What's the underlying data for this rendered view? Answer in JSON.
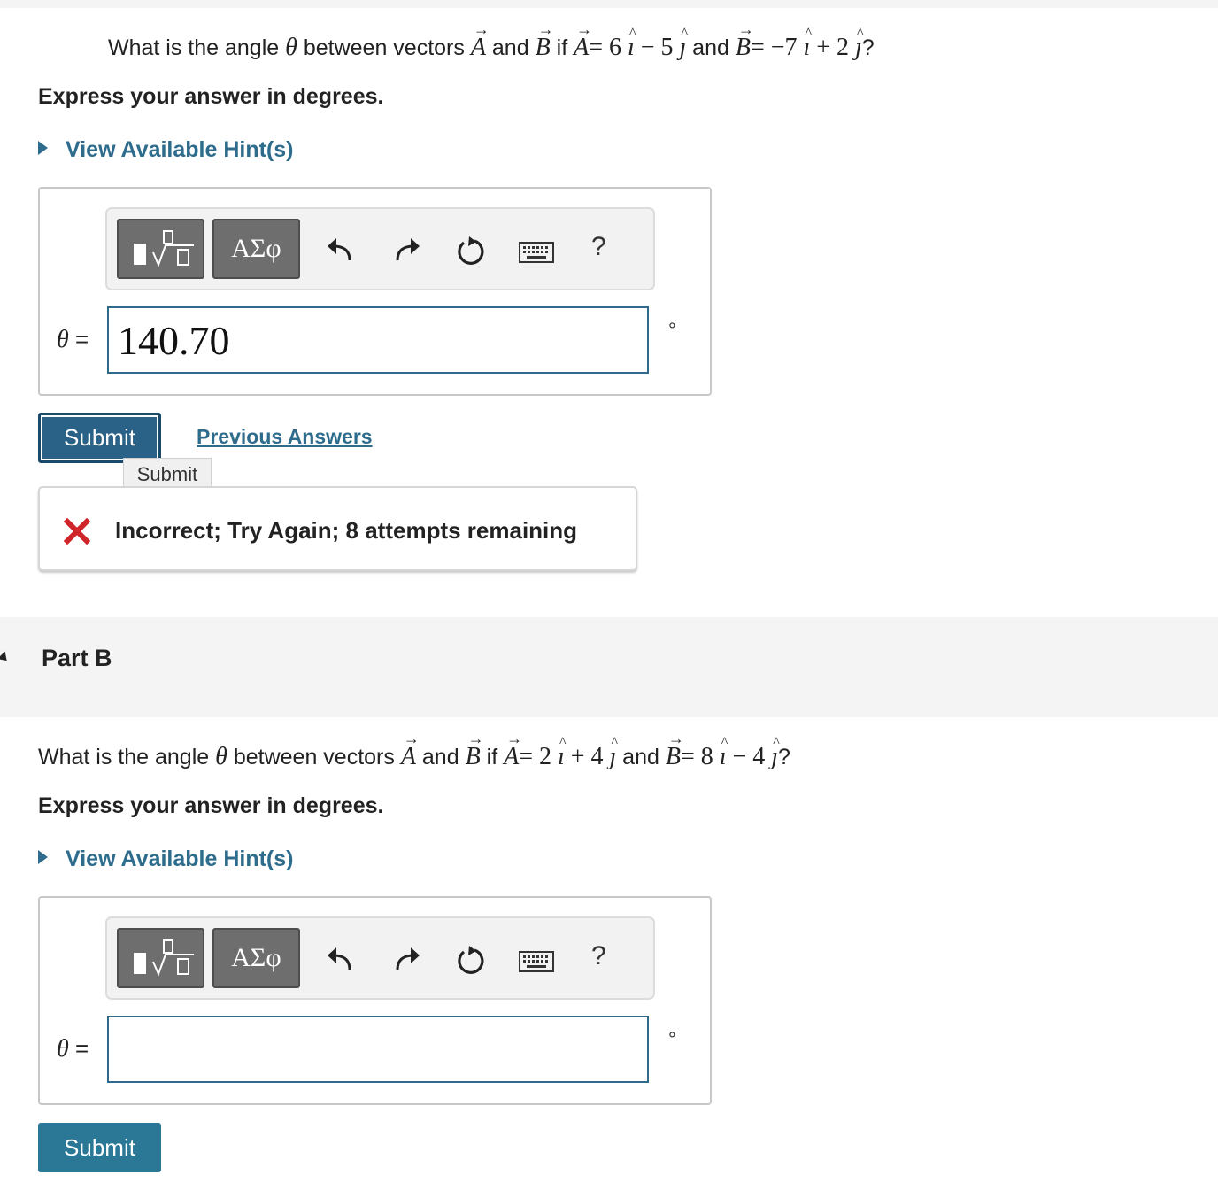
{
  "part_a": {
    "question": {
      "prefix": "What is the angle",
      "theta": "θ",
      "between": "between vectors",
      "a": "A",
      "and1": "and",
      "b": "B",
      "if": "if",
      "a2": "A",
      "eq1": "= 6",
      "i1": "ı",
      "op1": "− 5",
      "j1": "ȷ",
      "and2": "and",
      "b2": "B",
      "eq2": "= −7",
      "i2": "ı",
      "op2": "+ 2",
      "j2": "ȷ",
      "end": "?"
    },
    "instruction": "Express your answer in degrees.",
    "hint_label": "View Available Hint(s)",
    "toolbar": {
      "templates_label": "√",
      "greek_label": "ΑΣφ",
      "help_label": "?"
    },
    "theta_label": "θ",
    "equals": "=",
    "answer_value": "140.70",
    "unit": "°",
    "submit_label": "Submit",
    "previous_answers_label": "Previous Answers",
    "tooltip_label": "Submit",
    "feedback_text": "Incorrect; Try Again; 8 attempts remaining"
  },
  "part_b": {
    "title": "Part B",
    "question": {
      "prefix": "What is the angle",
      "theta": "θ",
      "between": "between vectors",
      "a": "A",
      "and1": "and",
      "b": "B",
      "if": "if",
      "a2": "A",
      "eq1": "= 2",
      "i1": "ı",
      "op1": "+ 4",
      "j1": "ȷ",
      "and2": "and",
      "b2": "B",
      "eq2": "= 8",
      "i2": "ı",
      "op2": "− 4",
      "j2": "ȷ",
      "end": "?"
    },
    "instruction": "Express your answer in degrees.",
    "hint_label": "View Available Hint(s)",
    "toolbar": {
      "templates_label": "√",
      "greek_label": "ΑΣφ",
      "help_label": "?"
    },
    "theta_label": "θ",
    "equals": "=",
    "answer_value": "",
    "unit": "°",
    "submit_label": "Submit"
  },
  "colors": {
    "accent": "#2a7896",
    "link": "#2d6c8c",
    "error": "#d0242b"
  }
}
